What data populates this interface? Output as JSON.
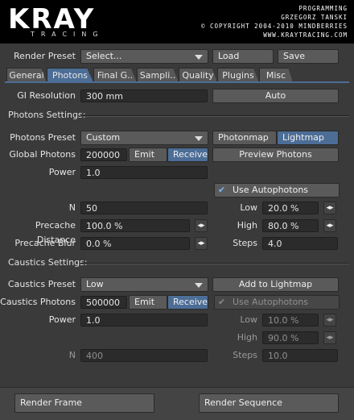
{
  "banner": {
    "logo_text": "KRAY",
    "logo_sub": "TRACING",
    "credit_line1": "PROGRAMMING",
    "credit_line2": "GRZEGORZ TANSKI",
    "credit_line3": "© COPYRIGHT 2004-2010 MINDBERRIES",
    "credit_line4": "WWW.KRAYTRACING.COM"
  },
  "top": {
    "render_preset_label": "Render Preset",
    "render_preset_value": "Select...",
    "load_label": "Load",
    "save_label": "Save"
  },
  "tabs": [
    {
      "label": "General"
    },
    {
      "label": "Photons"
    },
    {
      "label": "Final G.."
    },
    {
      "label": "Sampli.."
    },
    {
      "label": "Quality"
    },
    {
      "label": "Plugins"
    },
    {
      "label": "Misc"
    }
  ],
  "gi": {
    "label": "GI Resolution",
    "value": "300 mm",
    "auto_label": "Auto"
  },
  "photons": {
    "section_title": "Photons Settings:",
    "preset_label": "Photons Preset",
    "preset_value": "Custom",
    "photonmap_label": "Photonmap",
    "lightmap_label": "Lightmap",
    "global_label": "Global Photons",
    "global_value": "200000",
    "emit_label": "Emit",
    "receive_label": "Receive",
    "preview_label": "Preview Photons",
    "power_label": "Power",
    "power_value": "1.0",
    "use_autophotons_label": "Use Autophotons",
    "n_label": "N",
    "n_value": "50",
    "low_label": "Low",
    "low_value": "20.0 %",
    "precache_distance_label": "Precache Distance",
    "precache_distance_value": "100.0 %",
    "high_label": "High",
    "high_value": "80.0 %",
    "precache_blur_label": "Precache Blur",
    "precache_blur_value": "0.0 %",
    "steps_label": "Steps",
    "steps_value": "4.0"
  },
  "caustics": {
    "section_title": "Caustics Settings:",
    "preset_label": "Caustics Preset",
    "preset_value": "Low",
    "add_to_lightmap_label": "Add to Lightmap",
    "photons_label": "Caustics Photons",
    "photons_value": "500000",
    "emit_label": "Emit",
    "receive_label": "Receive",
    "use_autophotons_label": "Use Autophotons",
    "power_label": "Power",
    "power_value": "1.0",
    "low_label": "Low",
    "low_value": "10.0 %",
    "high_label": "High",
    "high_value": "90.0 %",
    "n_label": "N",
    "n_value": "400",
    "steps_label": "Steps",
    "steps_value": "10.0"
  },
  "bottom": {
    "render_frame_label": "Render Frame",
    "render_sequence_label": "Render Sequence"
  },
  "icons": {
    "slider_arrows": "◂▸",
    "check_mark": "✔"
  }
}
